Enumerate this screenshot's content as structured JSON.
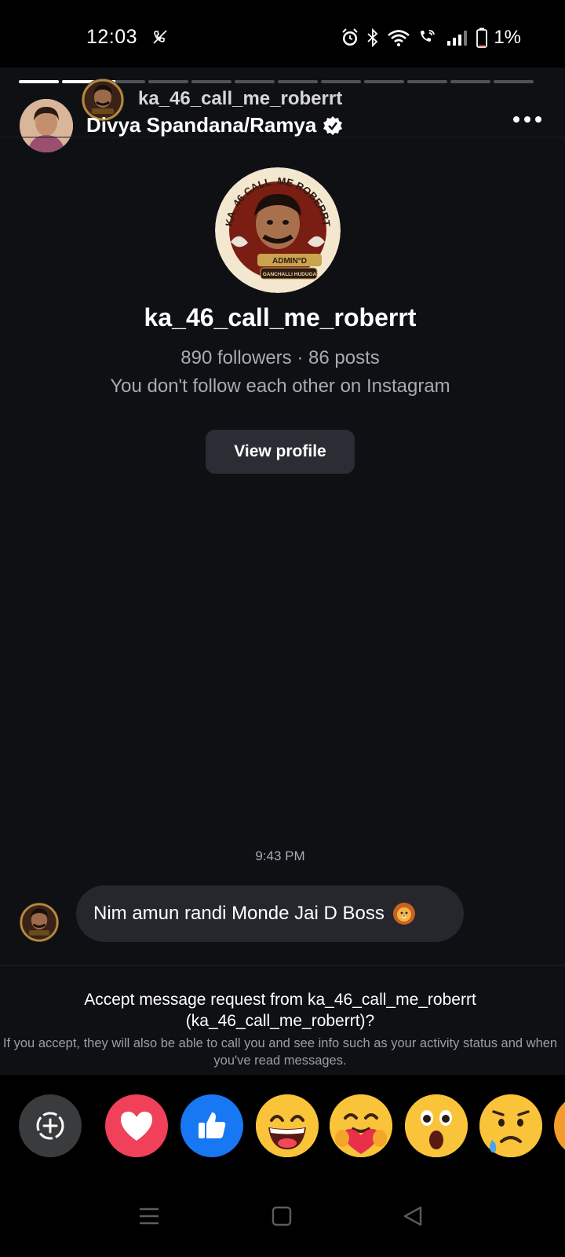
{
  "status_bar": {
    "time": "12:03",
    "battery_percent": "1%",
    "icons": [
      "call-muted-icon",
      "alarm-icon",
      "bluetooth-icon",
      "wifi-icon",
      "wifi-call-icon",
      "signal-icon",
      "battery-icon"
    ]
  },
  "story": {
    "segments": 12,
    "segments_complete": 2,
    "current_segment_fraction": 0.25
  },
  "header": {
    "sender_username": "ka_46_call_me_roberrt",
    "owner_name": "Divya Spandana/Ramya",
    "verified": true
  },
  "profile": {
    "username": "ka_46_call_me_roberrt",
    "stats": "890 followers · 86 posts",
    "relation": "You don't follow each other on Instagram",
    "view_profile_label": "View profile",
    "avatar_texts": {
      "ring_top": "KA_46 CALL_ME ROBERRT",
      "badge_1": "ADMIN°D",
      "badge_2": "GANCHALLI HUDUGA"
    }
  },
  "thread": {
    "timestamp": "9:43 PM",
    "message_text": "Nim amun randi Monde Jai D Boss",
    "message_emoji": "lion-face-icon"
  },
  "request": {
    "title": "Accept message request from ka_46_call_me_roberrt (ka_46_call_me_roberrt)?",
    "note": "If you accept, they will also be able to call you and see info such as your activity status and when you've read messages."
  },
  "reactions": [
    "add-reaction",
    "heart",
    "thumbs-up",
    "grinning-face",
    "hugging-face",
    "astonished-face",
    "sad-relieved-face",
    "partial-emoji"
  ],
  "colors": {
    "background": "#0e1014",
    "bubble": "#25272d",
    "button": "#2a2d33",
    "heart": "#f0405a",
    "like": "#1877f2"
  }
}
